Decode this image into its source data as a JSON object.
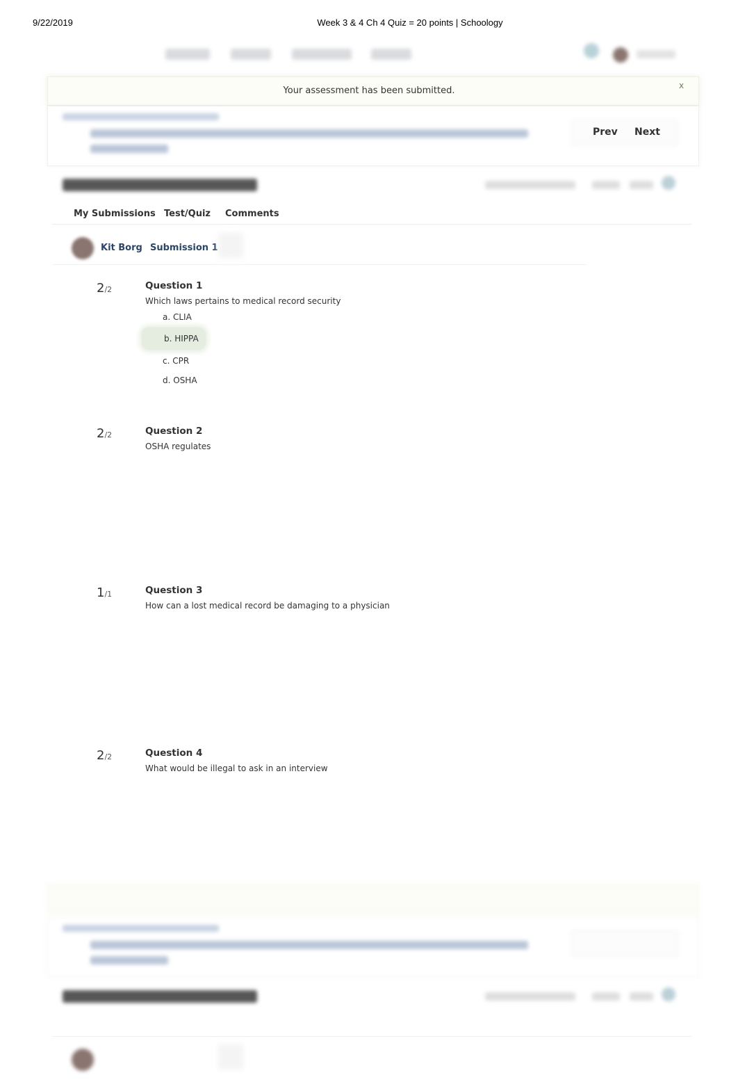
{
  "print_header": {
    "date": "9/22/2019",
    "title": "Week 3 & 4 Ch 4 Quiz = 20 points | Schoology"
  },
  "alert": {
    "message": "Your assessment has been submitted.",
    "close_label": "x"
  },
  "pager": {
    "prev_label": "Prev",
    "next_label": "Next"
  },
  "tabs": [
    {
      "label": "My Submissions"
    },
    {
      "label": "Test/Quiz"
    },
    {
      "label": "Comments"
    }
  ],
  "submission": {
    "student_name": "Kit Borg",
    "submission_label": "Submission 1"
  },
  "questions": [
    {
      "score": "2",
      "max": "/2",
      "title": "Question 1",
      "text": "Which laws pertains to medical record security",
      "options": [
        "a. CLIA",
        "b. HIPPA",
        "c. CPR",
        "d. OSHA"
      ],
      "selected_option": "b. HIPPA"
    },
    {
      "score": "2",
      "max": "/2",
      "title": "Question 2",
      "text": "OSHA regulates"
    },
    {
      "score": "1",
      "max": "/1",
      "title": "Question 3",
      "text": "How can a lost medical record be damaging to a physician"
    },
    {
      "score": "2",
      "max": "/2",
      "title": "Question 4",
      "text": "What would be illegal to ask in an interview"
    }
  ],
  "colors": {
    "correct_highlight": "#e5ede0",
    "link_navy": "#2c4668",
    "close_green": "#6b7d61"
  }
}
